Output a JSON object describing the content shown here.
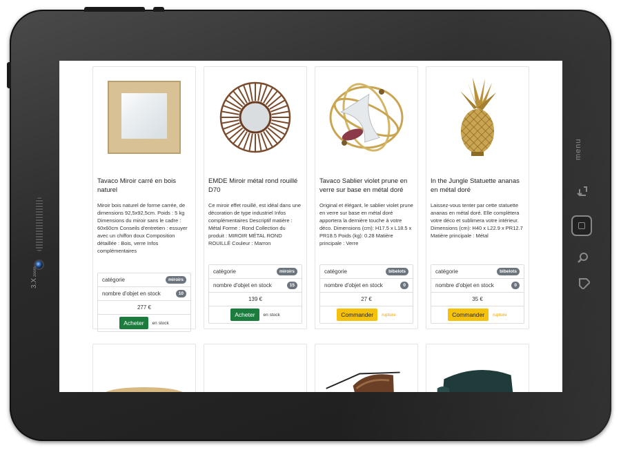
{
  "device": {
    "zoom_label": "3.X",
    "zoom_sub": "zoom",
    "menu_label": "menu"
  },
  "products": [
    {
      "title": "Tavaco Miroir carré en bois naturel",
      "description": "Miroir bois naturel de forme carrée, de dimensions 92,5x92,5cm. Poids : 5 kg Dimensions du miroir sans le cadre : 60x60cm Conseils d'entretien : essuyer avec un chiffon doux Composition détaillée : Bois, verre Infos complémentaires",
      "category_label": "catégorie",
      "category": "miroirs",
      "stock_label": "nombre d'objet en stock",
      "stock": "10",
      "price": "277 €",
      "action": "Acheter",
      "status": "en stock",
      "in_stock": true,
      "image": "square-wood-mirror"
    },
    {
      "title": "EMDE Miroir métal rond rouillé D70",
      "description": "Ce miroir effet rouillé, est idéal dans une décoration de type industriel Infos complémentaires Descriptif matière : Métal Forme : Rond Collection du produit : MIROIR MÉTAL ROND ROUILLÉ Couleur : Marron",
      "category_label": "catégorie",
      "category": "miroirs",
      "stock_label": "nombre d'objet en stock",
      "stock": "15",
      "price": "139 €",
      "action": "Acheter",
      "status": "en stock",
      "in_stock": true,
      "image": "round-rust-mirror"
    },
    {
      "title": "Tavaco Sablier violet prune en verre sur base en métal doré",
      "description": "Original et élégant, le sablier violet prune en verre sur base en métal doré apportera la dernière touche à votre déco. Dimensions (cm): H17.5 x L18.5 x PR18.5 Poids (kg): 0.28 Matière principale : Verre",
      "category_label": "catégorie",
      "category": "bibelots",
      "stock_label": "nombre d'objet en stock",
      "stock": "0",
      "price": "27 €",
      "action": "Commander",
      "status": "rupture",
      "in_stock": false,
      "image": "hourglass-gold"
    },
    {
      "title": "In the Jungle Statuette ananas en métal doré",
      "description": "Laissez-vous tenter par cette statuette ananas en métal doré. Elle complètera votre déco et sublimera votre intérieur. Dimensions (cm): H40 x L22.9 x PR12.7 Matière principale : Métal",
      "category_label": "catégorie",
      "category": "bibelots",
      "stock_label": "nombre d'objet en stock",
      "stock": "0",
      "price": "35 €",
      "action": "Commander",
      "status": "rupture",
      "in_stock": false,
      "image": "gold-pineapple"
    }
  ],
  "second_row": [
    {
      "image": "round-coffee-table"
    },
    {
      "image": "industrial-chest"
    },
    {
      "image": "leather-armchair"
    },
    {
      "image": "green-velvet-armchair"
    }
  ]
}
